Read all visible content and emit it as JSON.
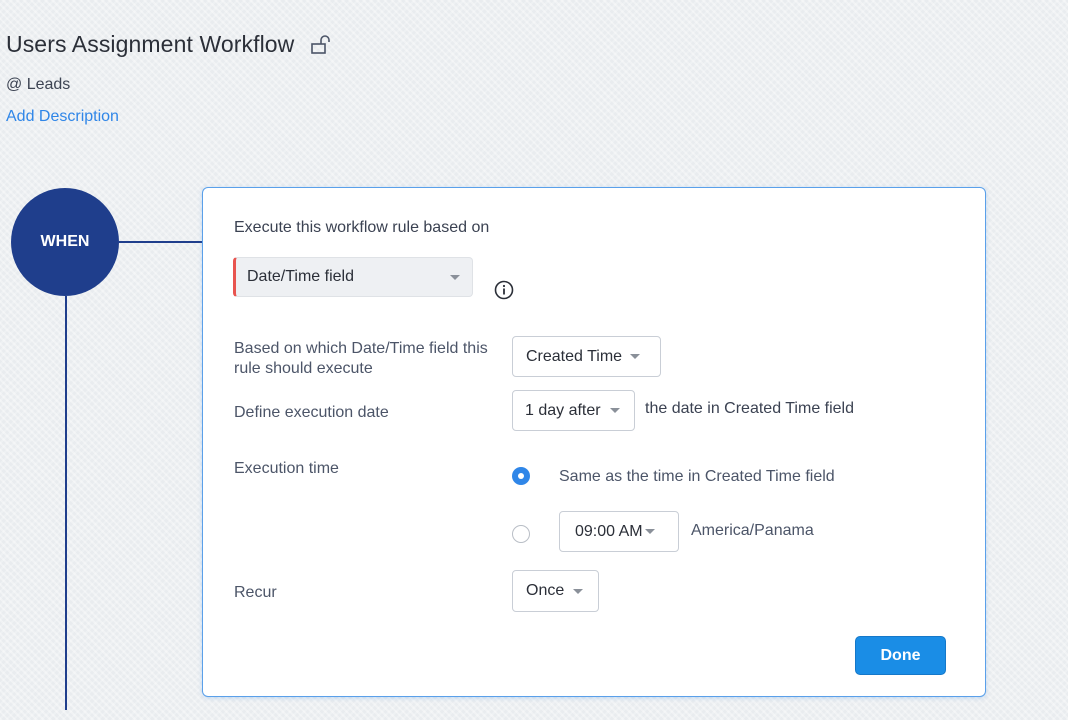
{
  "header": {
    "title": "Users Assignment Workflow",
    "module": "@ Leads",
    "add_description": "Add Description"
  },
  "flow": {
    "when_label": "WHEN"
  },
  "rule": {
    "heading": "Execute this workflow rule based on",
    "trigger_type": "Date/Time field",
    "based_on_label": "Based on which Date/Time field this rule should execute",
    "based_on_value": "Created Time",
    "execution_date_label": "Define execution date",
    "execution_date_value": "1 day after",
    "execution_date_suffix": "the date in Created Time field",
    "execution_time_label": "Execution time",
    "execution_time_option_same": "Same as the time in Created Time field",
    "execution_time_value": "09:00 AM",
    "timezone": "America/Panama",
    "recur_label": "Recur",
    "recur_value": "Once",
    "done_label": "Done"
  },
  "colors": {
    "accent": "#2f86e8",
    "when_circle": "#1f3e8c",
    "required_marker": "#e8544f",
    "done_button": "#1a8de6"
  },
  "icons": {
    "lock": "unlock-icon",
    "info": "info-icon",
    "caret": "caret-down-icon"
  }
}
